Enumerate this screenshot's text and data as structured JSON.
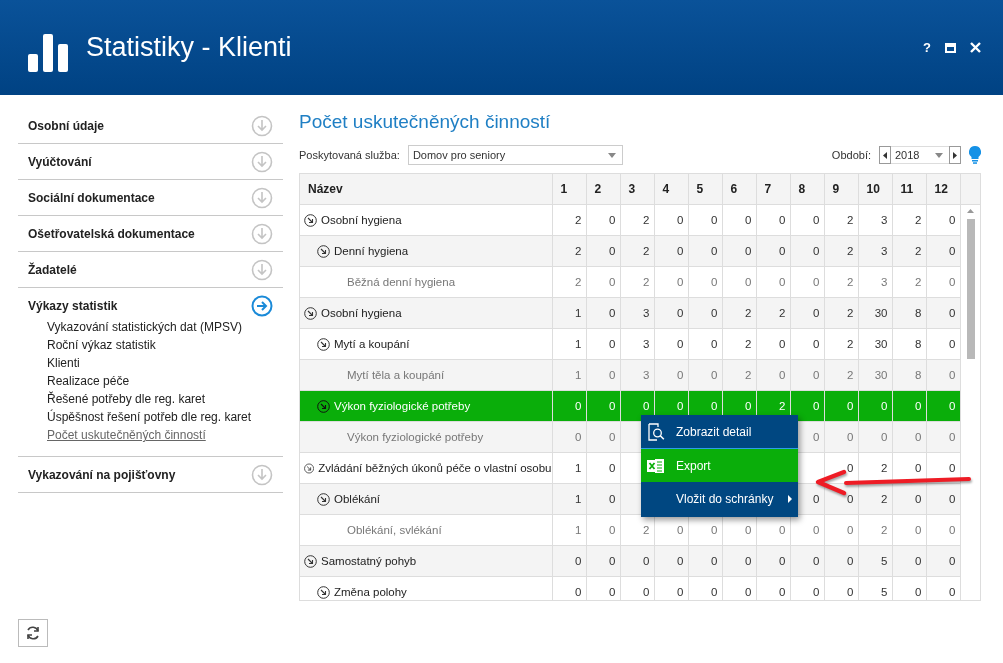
{
  "window": {
    "title": "Statistiky - Klienti",
    "help": "?"
  },
  "sidebar": {
    "sections": [
      {
        "label": "Osobní údaje",
        "expanded": false
      },
      {
        "label": "Vyúčtování",
        "expanded": false
      },
      {
        "label": "Sociální dokumentace",
        "expanded": false
      },
      {
        "label": "Ošetřovatelská dokumentace",
        "expanded": false
      },
      {
        "label": "Žadatelé",
        "expanded": false
      },
      {
        "label": "Výkazy statistik",
        "expanded": true,
        "items": [
          {
            "label": "Vykazování statistických dat (MPSV)",
            "selected": false
          },
          {
            "label": "Roční výkaz statistik",
            "selected": false
          },
          {
            "label": "Klienti",
            "selected": false
          },
          {
            "label": "Realizace péče",
            "selected": false
          },
          {
            "label": "Řešené potřeby dle reg. karet",
            "selected": false
          },
          {
            "label": "Úspěšnost řešení potřeb dle reg. karet",
            "selected": false
          },
          {
            "label": "Počet uskutečněných činností",
            "selected": true
          }
        ]
      },
      {
        "label": "Vykazování na pojišťovny",
        "expanded": false
      }
    ]
  },
  "main": {
    "title": "Počet uskutečněných činností",
    "service": {
      "label": "Poskytovaná služba:",
      "value": "Domov pro seniory"
    },
    "period": {
      "label": "Období:",
      "value": "2018"
    },
    "table": {
      "name_column": "Název",
      "columns": [
        "1",
        "2",
        "3",
        "4",
        "5",
        "6",
        "7",
        "8",
        "9",
        "10",
        "11",
        "12"
      ],
      "rows": [
        {
          "name": "Osobní hygiena",
          "kind": "group",
          "selected": false,
          "cells": [
            {
              "text": "2"
            },
            {
              "text": "0"
            },
            {
              "text": "2"
            },
            {
              "text": "0"
            },
            {
              "text": "0"
            },
            {
              "text": "0"
            },
            {
              "text": "0"
            },
            {
              "text": "0"
            },
            {
              "text": "2"
            },
            {
              "text": "3"
            },
            {
              "text": "2"
            },
            {
              "text": "0"
            }
          ],
          "children": [
            {
              "name": "Denní hygiena",
              "kind": "group",
              "selected": false,
              "cells": [
                {
                  "text": "2"
                },
                {
                  "text": "0"
                },
                {
                  "text": "2"
                },
                {
                  "text": "0"
                },
                {
                  "text": "0"
                },
                {
                  "text": "0"
                },
                {
                  "text": "0"
                },
                {
                  "text": "0"
                },
                {
                  "text": "2"
                },
                {
                  "text": "3"
                },
                {
                  "text": "2"
                },
                {
                  "text": "0"
                }
              ],
              "children": [
                {
                  "name": "Běžná denní hygiena",
                  "kind": "leaf",
                  "selected": false,
                  "cells": [
                    {
                      "text": "2"
                    },
                    {
                      "text": "0"
                    },
                    {
                      "text": "2"
                    },
                    {
                      "text": "0"
                    },
                    {
                      "text": "0"
                    },
                    {
                      "text": "0"
                    },
                    {
                      "text": "0"
                    },
                    {
                      "text": "0"
                    },
                    {
                      "text": "2"
                    },
                    {
                      "text": "3"
                    },
                    {
                      "text": "2"
                    },
                    {
                      "text": "0"
                    }
                  ]
                }
              ]
            }
          ]
        },
        {
          "name": "Osobní hygiena",
          "kind": "group",
          "selected": false,
          "cells": [
            {
              "text": "1"
            },
            {
              "text": "0"
            },
            {
              "text": "3"
            },
            {
              "text": "0"
            },
            {
              "text": "0"
            },
            {
              "text": "2"
            },
            {
              "text": "2"
            },
            {
              "text": "0"
            },
            {
              "text": "2"
            },
            {
              "text": "30"
            },
            {
              "text": "8"
            },
            {
              "text": "0"
            }
          ],
          "children": [
            {
              "name": "Mytí a koupání",
              "kind": "group",
              "selected": false,
              "cells": [
                {
                  "text": "1"
                },
                {
                  "text": "0"
                },
                {
                  "text": "3"
                },
                {
                  "text": "0"
                },
                {
                  "text": "0"
                },
                {
                  "text": "2"
                },
                {
                  "text": "0"
                },
                {
                  "text": "0"
                },
                {
                  "text": "2"
                },
                {
                  "text": "30"
                },
                {
                  "text": "8"
                },
                {
                  "text": "0"
                }
              ],
              "children": [
                {
                  "name": "Mytí těla a koupání",
                  "kind": "leaf",
                  "selected": false,
                  "cells": [
                    {
                      "text": "1"
                    },
                    {
                      "text": "0"
                    },
                    {
                      "text": "3"
                    },
                    {
                      "text": "0"
                    },
                    {
                      "text": "0"
                    },
                    {
                      "text": "2"
                    },
                    {
                      "text": "0"
                    },
                    {
                      "text": "0"
                    },
                    {
                      "text": "2"
                    },
                    {
                      "text": "30"
                    },
                    {
                      "text": "8"
                    },
                    {
                      "text": "0"
                    }
                  ]
                }
              ]
            },
            {
              "name": "Výkon fyziologické potřeby",
              "kind": "group",
              "selected": true,
              "cells": [
                {
                  "text": "0"
                },
                {
                  "text": "0"
                },
                {
                  "text": "0"
                },
                {
                  "text": "0"
                },
                {
                  "text": "0"
                },
                {
                  "text": "0"
                },
                {
                  "text": "2"
                },
                {
                  "text": "0"
                },
                {
                  "text": "0"
                },
                {
                  "text": "0"
                },
                {
                  "text": "0"
                },
                {
                  "text": "0"
                }
              ],
              "children": [
                {
                  "name": "Výkon fyziologické potřeby",
                  "kind": "leaf",
                  "selected": false,
                  "cells": [
                    {
                      "text": "0"
                    },
                    {
                      "text": "0"
                    }
                  ],
                  "cells_end": [
                    {
                      "text": "0"
                    },
                    {
                      "text": "0"
                    },
                    {
                      "text": "0"
                    },
                    {
                      "text": "0"
                    },
                    {
                      "text": "0"
                    }
                  ]
                }
              ]
            }
          ]
        },
        {
          "name": "Zvládání běžných úkonů péče o vlastní osobu",
          "kind": "group",
          "selected": false,
          "cells": [
            {
              "text": "1"
            },
            {
              "text": "0"
            }
          ],
          "cells_end": [
            {
              "text": "0"
            },
            {
              "text": "2"
            },
            {
              "text": "0"
            },
            {
              "text": "0"
            }
          ],
          "children": [
            {
              "name": "Oblékání",
              "kind": "group",
              "selected": false,
              "cells": [
                {
                  "text": "1"
                },
                {
                  "text": "0"
                }
              ],
              "cells_end": [
                {
                  "text": "0"
                },
                {
                  "text": "0"
                },
                {
                  "text": "2"
                },
                {
                  "text": "0"
                },
                {
                  "text": "0"
                }
              ],
              "children": [
                {
                  "name": "Oblékání, svlékání",
                  "kind": "leaf",
                  "selected": false,
                  "cells": [
                    {
                      "text": "1"
                    },
                    {
                      "text": "0"
                    },
                    {
                      "text": "2"
                    },
                    {
                      "text": "0"
                    },
                    {
                      "text": "0"
                    },
                    {
                      "text": "0"
                    },
                    {
                      "text": "0"
                    },
                    {
                      "text": "0"
                    },
                    {
                      "text": "0"
                    },
                    {
                      "text": "2"
                    },
                    {
                      "text": "0"
                    },
                    {
                      "text": "0"
                    }
                  ]
                }
              ]
            }
          ]
        },
        {
          "name": "Samostatný pohyb",
          "kind": "group",
          "selected": false,
          "cells": [
            {
              "text": "0"
            },
            {
              "text": "0"
            },
            {
              "text": "0"
            },
            {
              "text": "0"
            },
            {
              "text": "0"
            },
            {
              "text": "0"
            },
            {
              "text": "0"
            },
            {
              "text": "0"
            },
            {
              "text": "0"
            },
            {
              "text": "5"
            },
            {
              "text": "0"
            },
            {
              "text": "0"
            }
          ],
          "children": [
            {
              "name": "Změna polohy",
              "kind": "group",
              "selected": false,
              "cells": [
                {
                  "text": "0"
                },
                {
                  "text": "0"
                },
                {
                  "text": "0"
                },
                {
                  "text": "0"
                },
                {
                  "text": "0"
                },
                {
                  "text": "0"
                },
                {
                  "text": "0"
                },
                {
                  "text": "0"
                },
                {
                  "text": "0"
                },
                {
                  "text": "5"
                },
                {
                  "text": "0"
                },
                {
                  "text": "0"
                }
              ]
            }
          ]
        }
      ]
    },
    "context_menu": [
      {
        "label": "Zobrazit detail",
        "kind": "detail",
        "selected": false
      },
      {
        "label": "Export",
        "kind": "excel",
        "selected": true
      },
      {
        "label": "Vložit do schránky",
        "kind": "submenu",
        "selected": false
      }
    ]
  }
}
